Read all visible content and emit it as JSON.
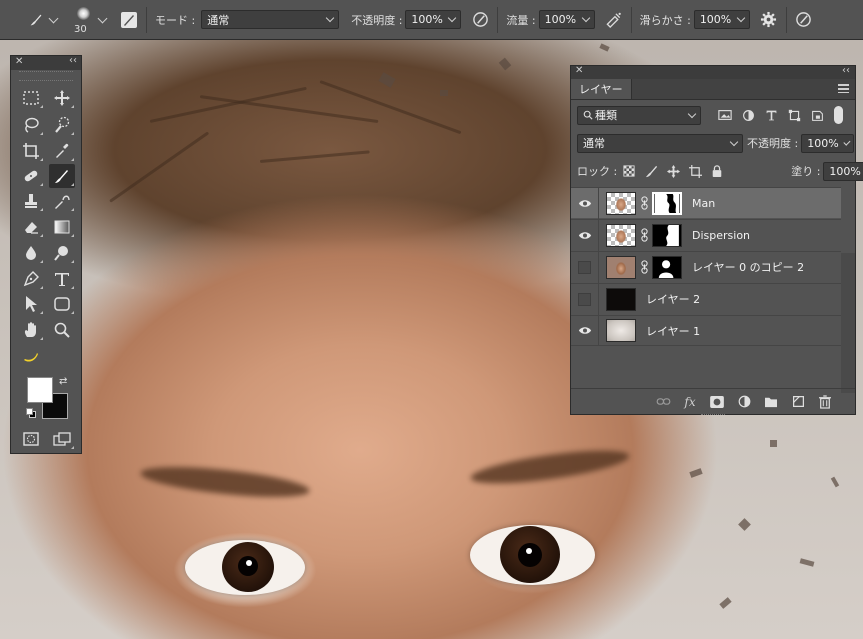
{
  "options_bar": {
    "brush_size": "30",
    "mode_label": "モード :",
    "mode_value": "通常",
    "opacity_label": "不透明度 :",
    "opacity_value": "100%",
    "flow_label": "流量 :",
    "flow_value": "100%",
    "smoothing_label": "滑らかさ :",
    "smoothing_value": "100%"
  },
  "layers_panel": {
    "tab_label": "レイヤー",
    "filter_kind": "種類",
    "blend_mode": "通常",
    "opacity_label": "不透明度 :",
    "opacity_value": "100%",
    "lock_label": "ロック :",
    "fill_label": "塗り :",
    "fill_value": "100%",
    "layers": [
      {
        "name": "Man",
        "visible": true,
        "selected": true
      },
      {
        "name": "Dispersion",
        "visible": true,
        "selected": false
      },
      {
        "name": "レイヤー 0 のコピー 2",
        "visible": false,
        "selected": false
      },
      {
        "name": "レイヤー 2",
        "visible": false,
        "selected": false
      },
      {
        "name": "レイヤー 1",
        "visible": true,
        "selected": false
      }
    ]
  },
  "tools_panel": {
    "foreground_color": "#ffffff",
    "background_color": "#000000",
    "active_tool": "brush-tool"
  }
}
